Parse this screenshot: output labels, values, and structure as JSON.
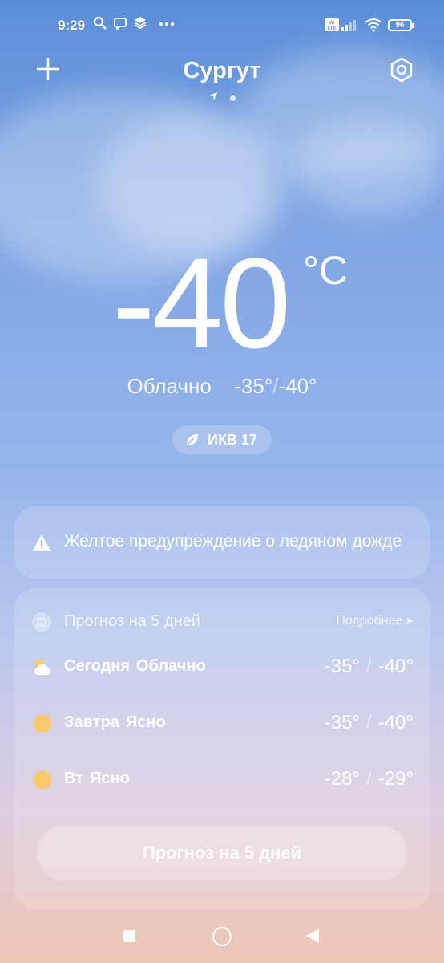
{
  "status_bar": {
    "time": "9:29",
    "icons": [
      "search-icon",
      "viber-icon",
      "layers-icon",
      "more-icon",
      "volte-icon",
      "signal-icon",
      "wifi-icon"
    ],
    "battery": "96"
  },
  "header": {
    "city": "Сургут"
  },
  "current": {
    "temperature": "-40",
    "unit": "°C",
    "condition": "Облачно",
    "high": "-35°",
    "low": "-40°",
    "aqi_label": "ИКВ 17"
  },
  "warning": {
    "text": "Желтое предупреждение о ледяном дожде"
  },
  "forecast": {
    "title": "Прогноз на 5 дней",
    "more_label": "Подробнее",
    "days": [
      {
        "day": "Сегодня",
        "condition": "Облачно",
        "high": "-35°",
        "low": "-40°",
        "icon": "partly-cloudy-icon"
      },
      {
        "day": "Завтра",
        "condition": "Ясно",
        "high": "-35°",
        "low": "-40°",
        "icon": "sun-icon"
      },
      {
        "day": "Вт",
        "condition": "Ясно",
        "high": "-28°",
        "low": "-29°",
        "icon": "sun-icon"
      }
    ],
    "button_label": "Прогноз на 5 дней"
  }
}
